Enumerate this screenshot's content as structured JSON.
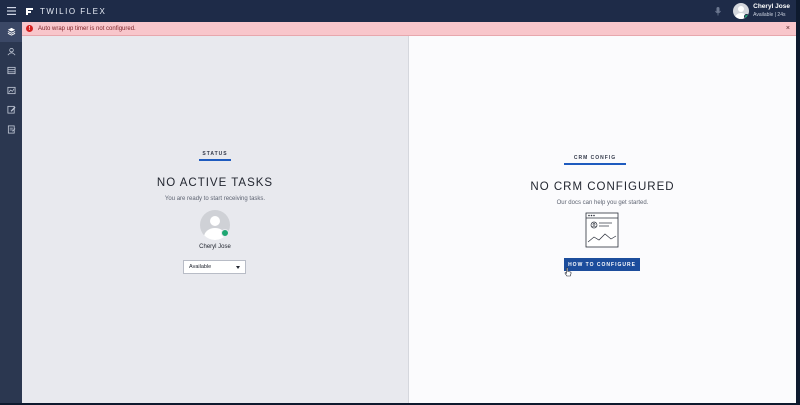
{
  "header": {
    "menu_icon": "hamburger-icon",
    "brand": "TWILIO FLEX",
    "user": {
      "name": "Cheryl Jose",
      "status": "Available | 24s"
    }
  },
  "alert": {
    "message": "Auto wrap up timer is not configured.",
    "close_label": "×",
    "icon_text": "!"
  },
  "sidebar": {
    "items": [
      {
        "icon": "layers-icon",
        "active": true
      },
      {
        "icon": "agents-icon",
        "active": false
      },
      {
        "icon": "queues-icon",
        "active": false
      },
      {
        "icon": "analytics-icon",
        "active": false
      },
      {
        "icon": "edit-icon",
        "active": false
      },
      {
        "icon": "notes-icon",
        "active": false
      }
    ]
  },
  "status_panel": {
    "tag": "STATUS",
    "title": "NO ACTIVE TASKS",
    "subtitle": "You are ready to start receiving tasks.",
    "agent_name": "Cheryl Jose",
    "activity": "Available"
  },
  "crm_panel": {
    "tag": "CRM CONFIG",
    "title": "NO CRM CONFIGURED",
    "subtitle": "Our docs can help you get started.",
    "button": "HOW TO CONFIGURE"
  },
  "colors": {
    "topbar": "#1e2b48",
    "sidebar": "#2b3750",
    "alert_bg": "#f8c6cb",
    "accent_blue": "#1c4d9c",
    "available_green": "#1ea672"
  }
}
